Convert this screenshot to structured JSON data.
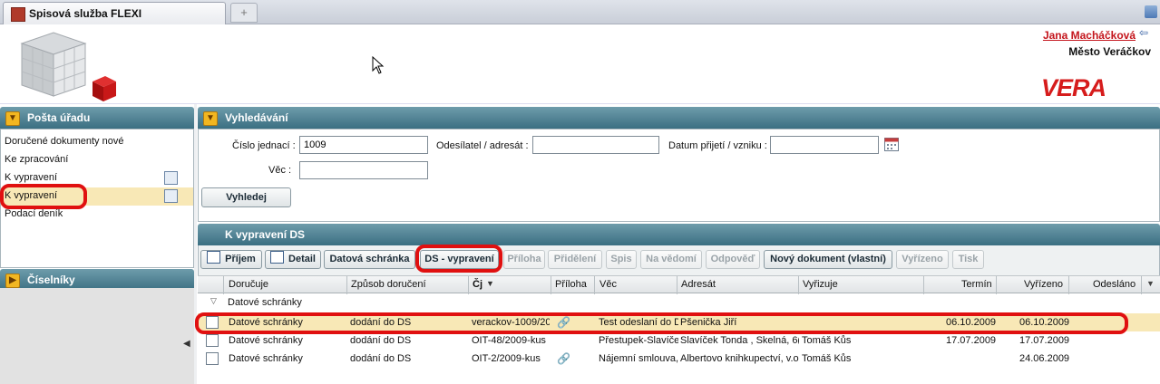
{
  "window": {
    "tab_title": "Spisová služba FLEXI",
    "new_tab_symbol": "+"
  },
  "header": {
    "user_name": "Jana Macháčková",
    "city": "Město Veráčkov",
    "logo_text": "VERA"
  },
  "left": {
    "posta_title": "Pošta úřadu",
    "nav": [
      "Doručené dokumenty nové",
      "Ke zpracování",
      "K vypravení",
      "K vypravení",
      "Podací deník"
    ],
    "ciselniky_title": "Číselníky",
    "collapse_symbol": "◀"
  },
  "search": {
    "title": "Vyhledávání",
    "cislo_label": "Číslo jednací :",
    "cislo_value": "1009",
    "odesilatel_label": "Odesílatel / adresát :",
    "odesilatel_value": "",
    "datum_label": "Datum přijetí / vzniku :",
    "datum_value": "",
    "vec_label": "Věc :",
    "vec_value": "",
    "search_button": "Vyhledej"
  },
  "list": {
    "title": "K vypravení DS",
    "toolbar": [
      {
        "label": "Příjem",
        "enabled": true
      },
      {
        "label": "Detail",
        "enabled": true
      },
      {
        "label": "Datová schránka",
        "enabled": true
      },
      {
        "label": "DS - vypravení",
        "enabled": true
      },
      {
        "label": "Příloha",
        "enabled": false
      },
      {
        "label": "Přidělení",
        "enabled": false
      },
      {
        "label": "Spis",
        "enabled": false
      },
      {
        "label": "Na vědomí",
        "enabled": false
      },
      {
        "label": "Odpověď",
        "enabled": false
      },
      {
        "label": "Nový dokument (vlastní)",
        "enabled": true
      },
      {
        "label": "Vyřízeno",
        "enabled": false
      },
      {
        "label": "Tisk",
        "enabled": false
      }
    ],
    "columns": [
      "Doručuje",
      "Způsob doručení",
      "Čj",
      "Příloha",
      "Věc",
      "Adresát",
      "Vyřizuje",
      "Termín",
      "Vyřízeno",
      "Odesláno"
    ],
    "group_label": "Datové schránky",
    "rows": [
      {
        "dorucuje": "Datové schránky",
        "zpusob": "dodání do DS",
        "cj": "verackov-1009/20",
        "priloha": true,
        "vec": "Test odeslaní do D",
        "adresat": "Pšenička Jiří",
        "vyrizuje": "",
        "termin": "06.10.2009",
        "vyrizeno": "06.10.2009",
        "odeslano": ""
      },
      {
        "dorucuje": "Datové schránky",
        "zpusob": "dodání do DS",
        "cj": "OIT-48/2009-kus",
        "priloha": false,
        "vec": "Přestupek-Slavíče",
        "adresat": "Slavíček Tonda , Skelná, 6(",
        "vyrizuje": "Tomáš Kůs",
        "termin": "17.07.2009",
        "vyrizeno": "17.07.2009",
        "odeslano": ""
      },
      {
        "dorucuje": "Datové schránky",
        "zpusob": "dodání do DS",
        "cj": "OIT-2/2009-kus",
        "priloha": true,
        "vec": "Nájemní smlouva,",
        "adresat": "Albertovo knihkupectví, v.o",
        "vyrizuje": "Tomáš Kůs",
        "termin": "",
        "vyrizeno": "24.06.2009",
        "odeslano": ""
      }
    ]
  },
  "colors": {
    "panel_header": "#3b6f82",
    "highlight": "#f8e8b6",
    "annotation": "#e01010",
    "accent": "#f2b621"
  }
}
